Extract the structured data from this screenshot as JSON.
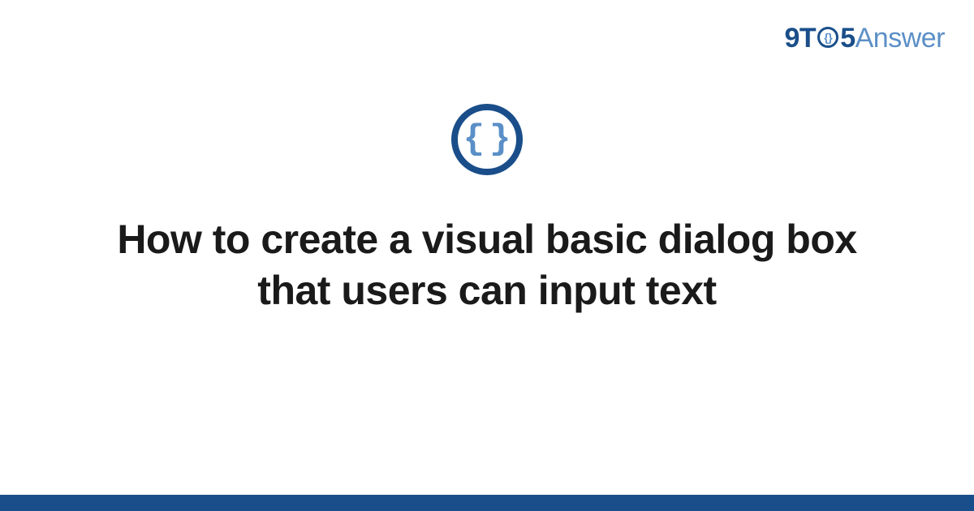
{
  "logo": {
    "part1": "9T",
    "clock_glyph": "{}",
    "part2": "5",
    "part3": "Answer"
  },
  "icon": {
    "name": "code-braces-icon",
    "glyph": "{}"
  },
  "title": "How to create a visual basic dialog box that users can input text",
  "colors": {
    "primary": "#1a4e8a",
    "secondary": "#5b8fc7",
    "text": "#1a1a1a",
    "background": "#ffffff"
  }
}
